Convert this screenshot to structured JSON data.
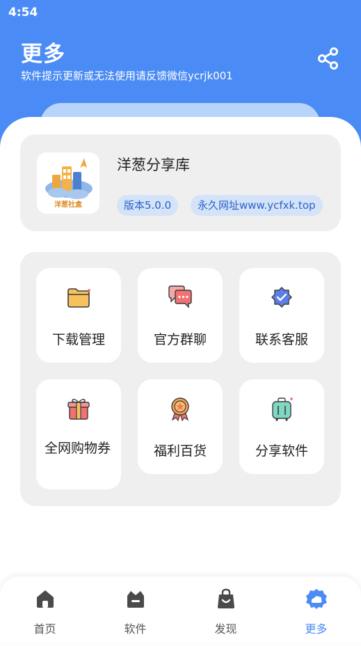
{
  "status_bar": {
    "time": "4:54"
  },
  "header": {
    "title": "更多",
    "subtitle": "软件提示更新或无法使用请反馈微信ycrjk001",
    "share_icon": "share-icon"
  },
  "app_card": {
    "logo_text": "洋葱社盒",
    "name": "洋葱分享库",
    "version_badge": "版本5.0.0",
    "site_badge": "永久网址www.ycfxk.top"
  },
  "grid": {
    "items": [
      {
        "label": "下载管理",
        "icon": "folder-icon"
      },
      {
        "label": "官方群聊",
        "icon": "chat-bubbles-icon"
      },
      {
        "label": "联系客服",
        "icon": "verified-badge-icon"
      },
      {
        "label": "全网购物券",
        "icon": "gift-icon"
      },
      {
        "label": "福利百货",
        "icon": "medal-icon"
      },
      {
        "label": "分享软件",
        "icon": "suitcase-icon"
      }
    ]
  },
  "tabbar": {
    "items": [
      {
        "label": "首页",
        "icon": "home-icon"
      },
      {
        "label": "软件",
        "icon": "apps-icon"
      },
      {
        "label": "发现",
        "icon": "bag-icon"
      },
      {
        "label": "更多",
        "icon": "more-cloud-icon"
      }
    ],
    "active_index": 3
  },
  "colors": {
    "header_blue": "#4a8bf5",
    "badge_text": "#2a63c8",
    "badge_bg": "#d4e3f8",
    "card_bg": "#efefef"
  }
}
